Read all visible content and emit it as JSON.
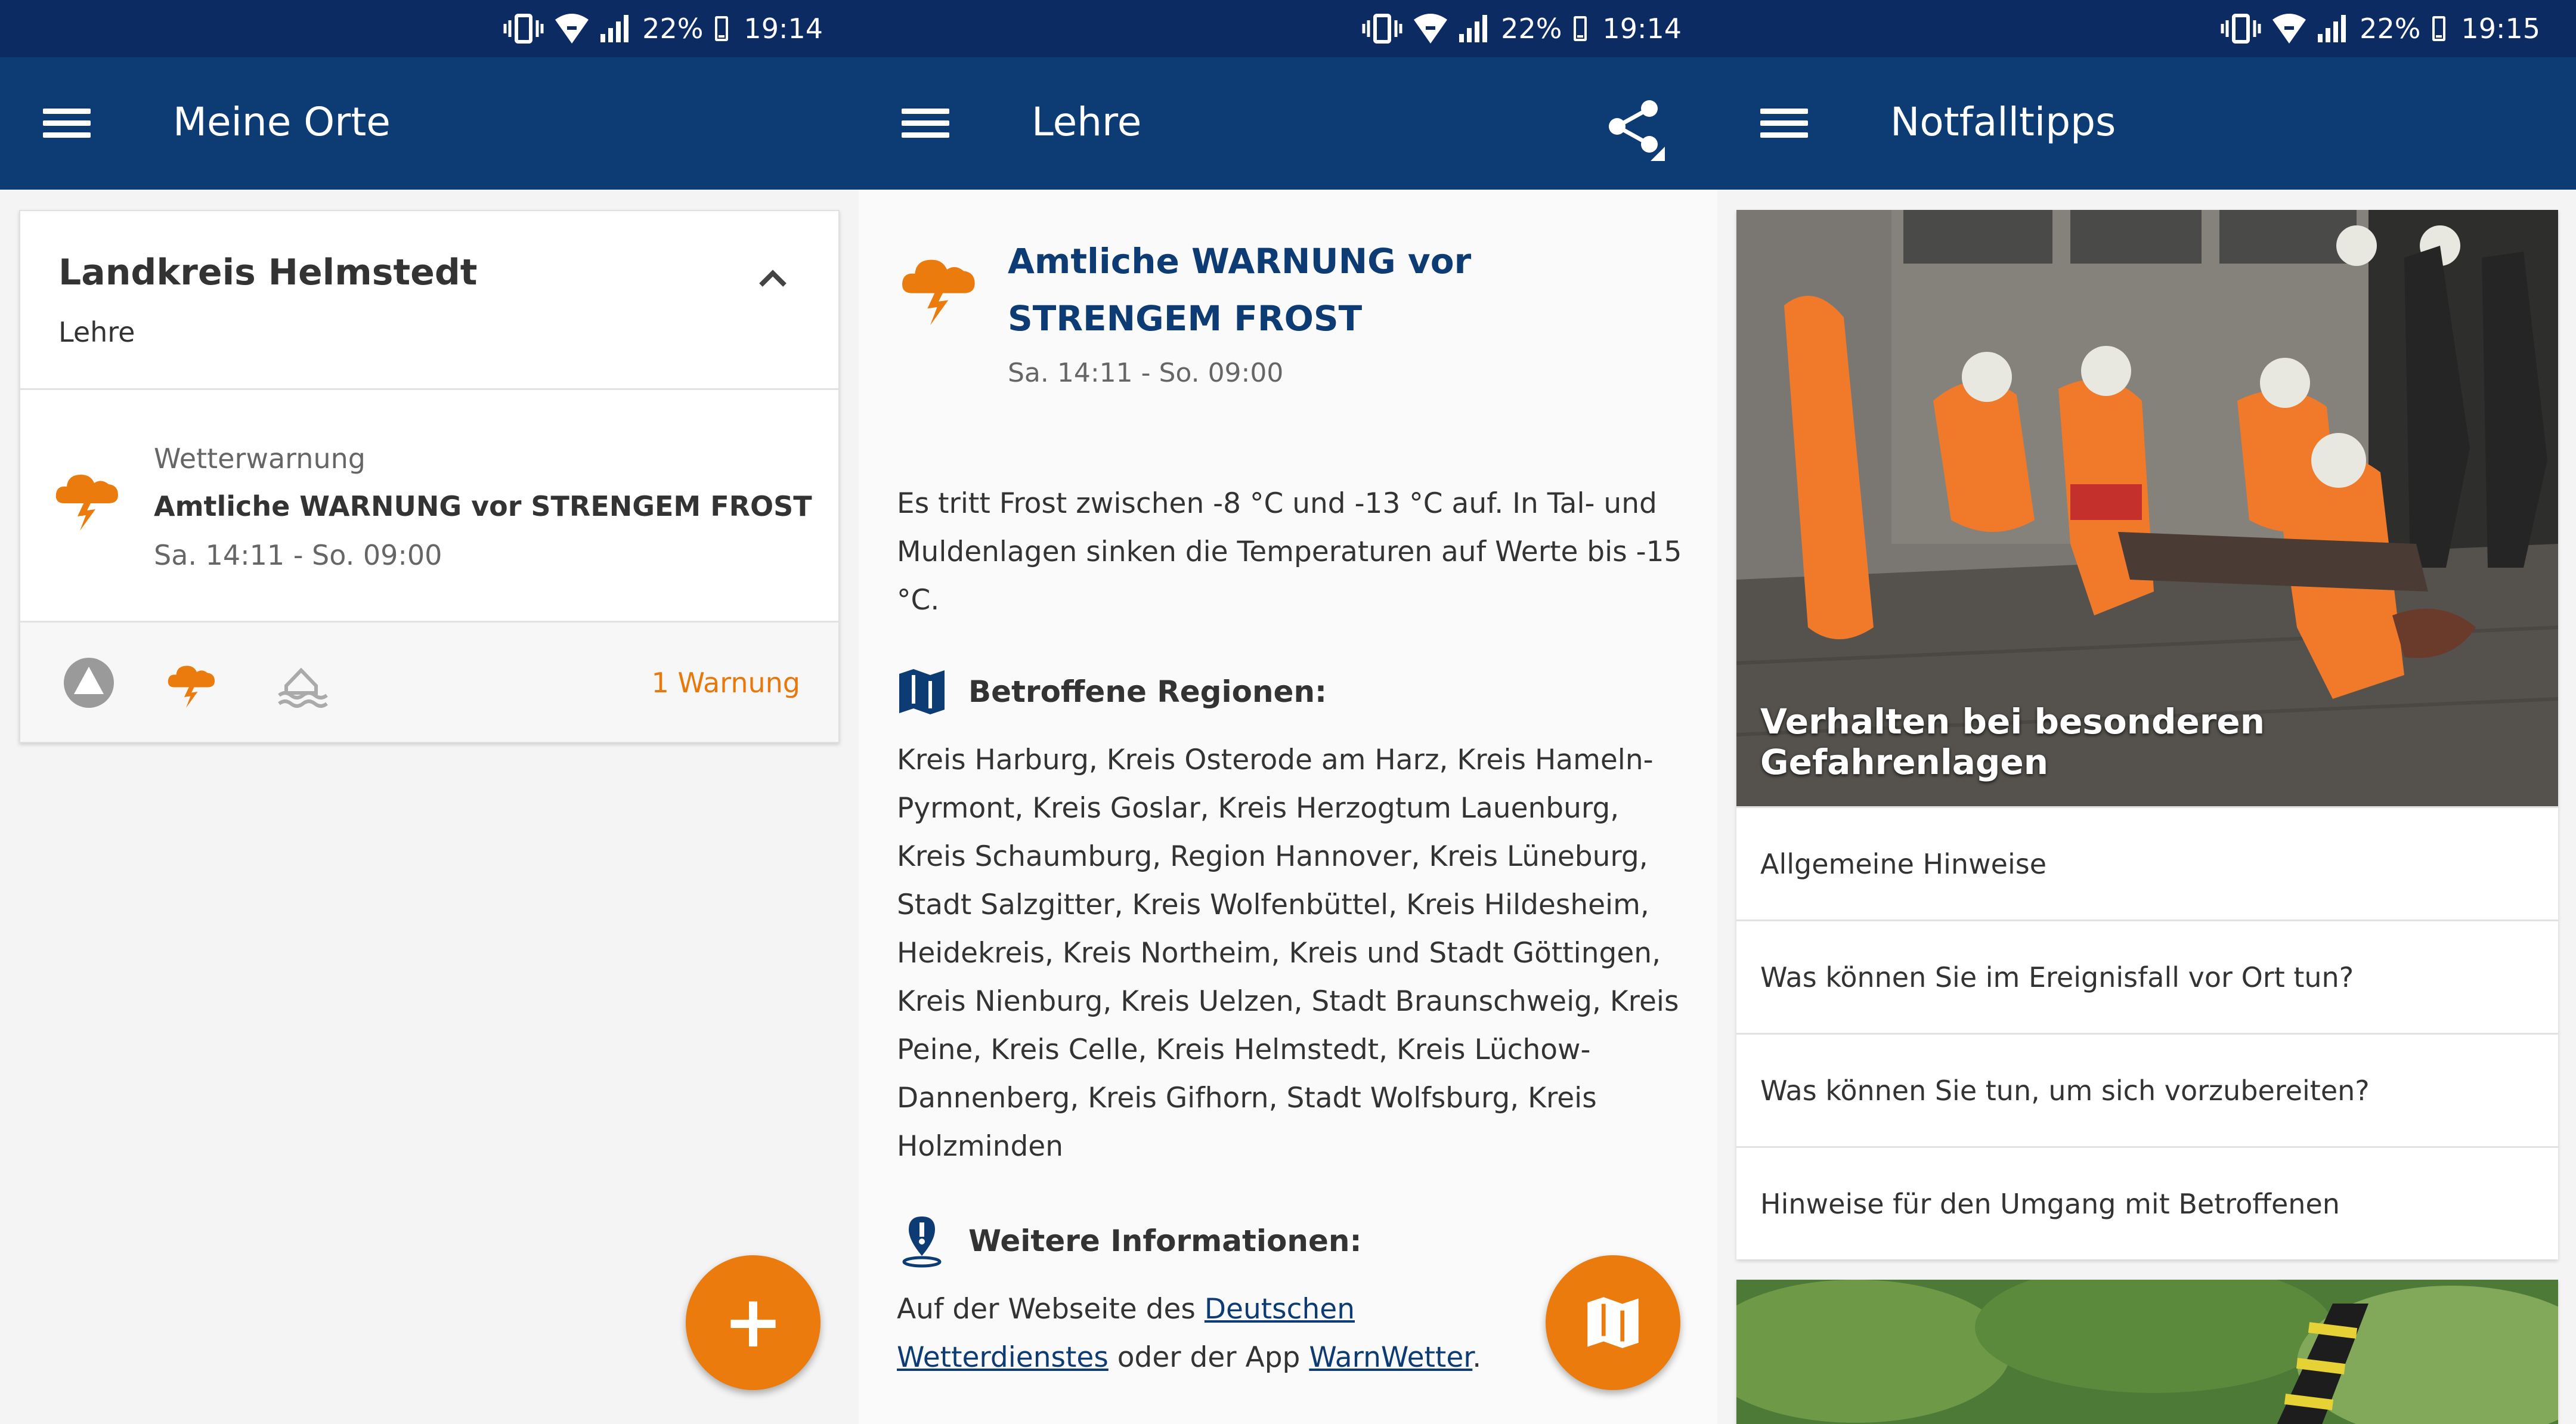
{
  "status_bars": [
    {
      "battery": "22%",
      "time": "19:14"
    },
    {
      "battery": "22%",
      "time": "19:14"
    },
    {
      "battery": "22%",
      "time": "19:15"
    }
  ],
  "screen1": {
    "title": "Meine Orte",
    "card": {
      "title": "Landkreis Helmstedt",
      "subtitle": "Lehre",
      "warning": {
        "type": "Wetterwarnung",
        "title": "Amtliche WARNUNG vor STRENGEM FROST",
        "time": "Sa. 14:11 - So. 09:00"
      },
      "count": "1 Warnung"
    },
    "fab_label": "+"
  },
  "screen2": {
    "title": "Lehre",
    "warning_title": "Amtliche WARNUNG vor STRENGEM FROST",
    "time": "Sa. 14:11 - So. 09:00",
    "description": "Es tritt Frost zwischen -8 °C und -13 °C auf. In Tal- und Muldenlagen sinken die Temperaturen auf Werte bis -15 °C.",
    "regions_heading": "Betroffene Regionen:",
    "regions": "Kreis Harburg, Kreis Osterode am Harz, Kreis Hameln-Pyrmont, Kreis Goslar, Kreis Herzogtum Lauenburg, Kreis Schaumburg, Region Hannover, Kreis Lüneburg, Stadt Salzgitter, Kreis Wolfenbüttel, Kreis Hildesheim, Heidekreis, Kreis Northeim, Kreis und Stadt Göttingen, Kreis Nienburg, Kreis Uelzen, Stadt Braunschweig, Kreis Peine, Kreis Celle, Kreis Helmstedt, Kreis Lüchow-Dannenberg, Kreis Gifhorn, Stadt Wolfsburg, Kreis Holzminden",
    "info_heading": "Weitere Informationen:",
    "info_pre": "Auf der Webseite des ",
    "info_link1": "Deutschen Wetterdienstes",
    "info_mid": " oder der App ",
    "info_link2": "WarnWetter",
    "info_post": "."
  },
  "screen3": {
    "title": "Notfalltipps",
    "photo_caption": "Verhalten bei besonderen Gefahrenlagen",
    "links": [
      "Allgemeine Hinweise",
      "Was können Sie im Ereignisfall vor Ort tun?",
      "Was können Sie tun, um sich vorzubereiten?",
      "Hinweise für den Umgang mit Betroffenen"
    ]
  },
  "colors": {
    "appbar": "#0d3b73",
    "statusbar": "#0d2b63",
    "accent": "#ea7b0c"
  },
  "icons": [
    "menu-icon",
    "share-icon",
    "chevron-up-icon",
    "weather-warning-icon",
    "warning-triangle-icon",
    "flood-icon",
    "map-icon",
    "info-pin-icon",
    "plus-icon"
  ]
}
